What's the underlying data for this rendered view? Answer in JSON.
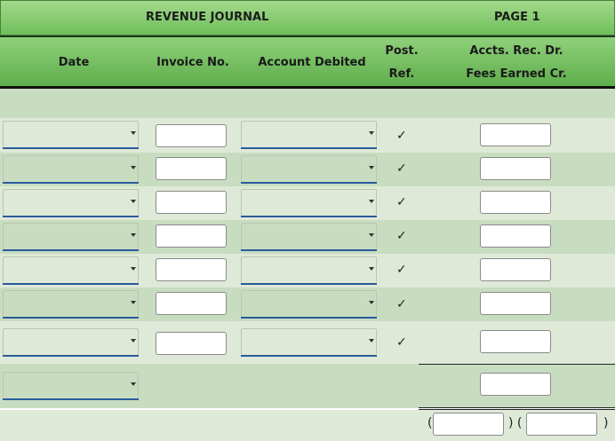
{
  "journal": {
    "title": "REVENUE JOURNAL",
    "page": "PAGE 1",
    "columns": {
      "date": "Date",
      "invoice": "Invoice No.",
      "account": "Account Debited",
      "post_ref_1": "Post.",
      "post_ref_2": "Ref.",
      "amount_1": "Accts. Rec. Dr.",
      "amount_2": "Fees Earned Cr."
    },
    "rows": [
      {
        "date": "",
        "invoice": "",
        "account": "",
        "post_ref": "✓",
        "amount": ""
      },
      {
        "date": "",
        "invoice": "",
        "account": "",
        "post_ref": "✓",
        "amount": ""
      },
      {
        "date": "",
        "invoice": "",
        "account": "",
        "post_ref": "✓",
        "amount": ""
      },
      {
        "date": "",
        "invoice": "",
        "account": "",
        "post_ref": "✓",
        "amount": ""
      },
      {
        "date": "",
        "invoice": "",
        "account": "",
        "post_ref": "✓",
        "amount": ""
      },
      {
        "date": "",
        "invoice": "",
        "account": "",
        "post_ref": "✓",
        "amount": ""
      },
      {
        "date": "",
        "invoice": "",
        "account": "",
        "post_ref": "✓",
        "amount": ""
      }
    ],
    "total_row": {
      "date": "",
      "amount": ""
    },
    "posting_refs": {
      "open": "(",
      "mid": ") (",
      "close": ")",
      "debit_ref": "",
      "credit_ref": ""
    }
  }
}
